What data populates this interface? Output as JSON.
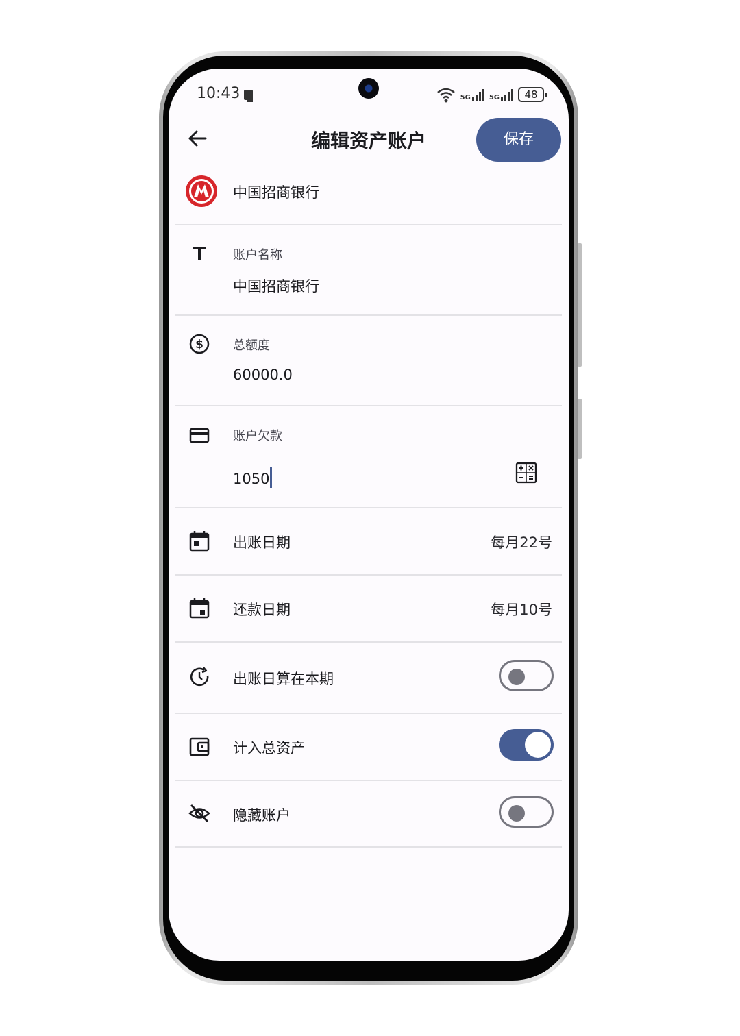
{
  "status_bar": {
    "time": "10:43",
    "network_1": "5G",
    "network_2": "5G",
    "battery": "48"
  },
  "header": {
    "title": "编辑资产账户",
    "save_label": "保存"
  },
  "bank": {
    "name": "中国招商银行"
  },
  "fields": {
    "account_name": {
      "label": "账户名称",
      "value": "中国招商银行"
    },
    "total_limit": {
      "label": "总额度",
      "value": "60000.0"
    },
    "debt": {
      "label": "账户欠款",
      "value": "1050"
    }
  },
  "rows": {
    "billing_date": {
      "label": "出账日期",
      "value": "每月22号"
    },
    "repayment_date": {
      "label": "还款日期",
      "value": "每月10号"
    },
    "billing_day_current": {
      "label": "出账日算在本期",
      "enabled": false
    },
    "include_total_assets": {
      "label": "计入总资产",
      "enabled": true
    },
    "hide_account": {
      "label": "隐藏账户",
      "enabled": false
    }
  },
  "colors": {
    "accent": "#465d94",
    "bank_red": "#d7262b",
    "background": "#fdfbfe"
  }
}
